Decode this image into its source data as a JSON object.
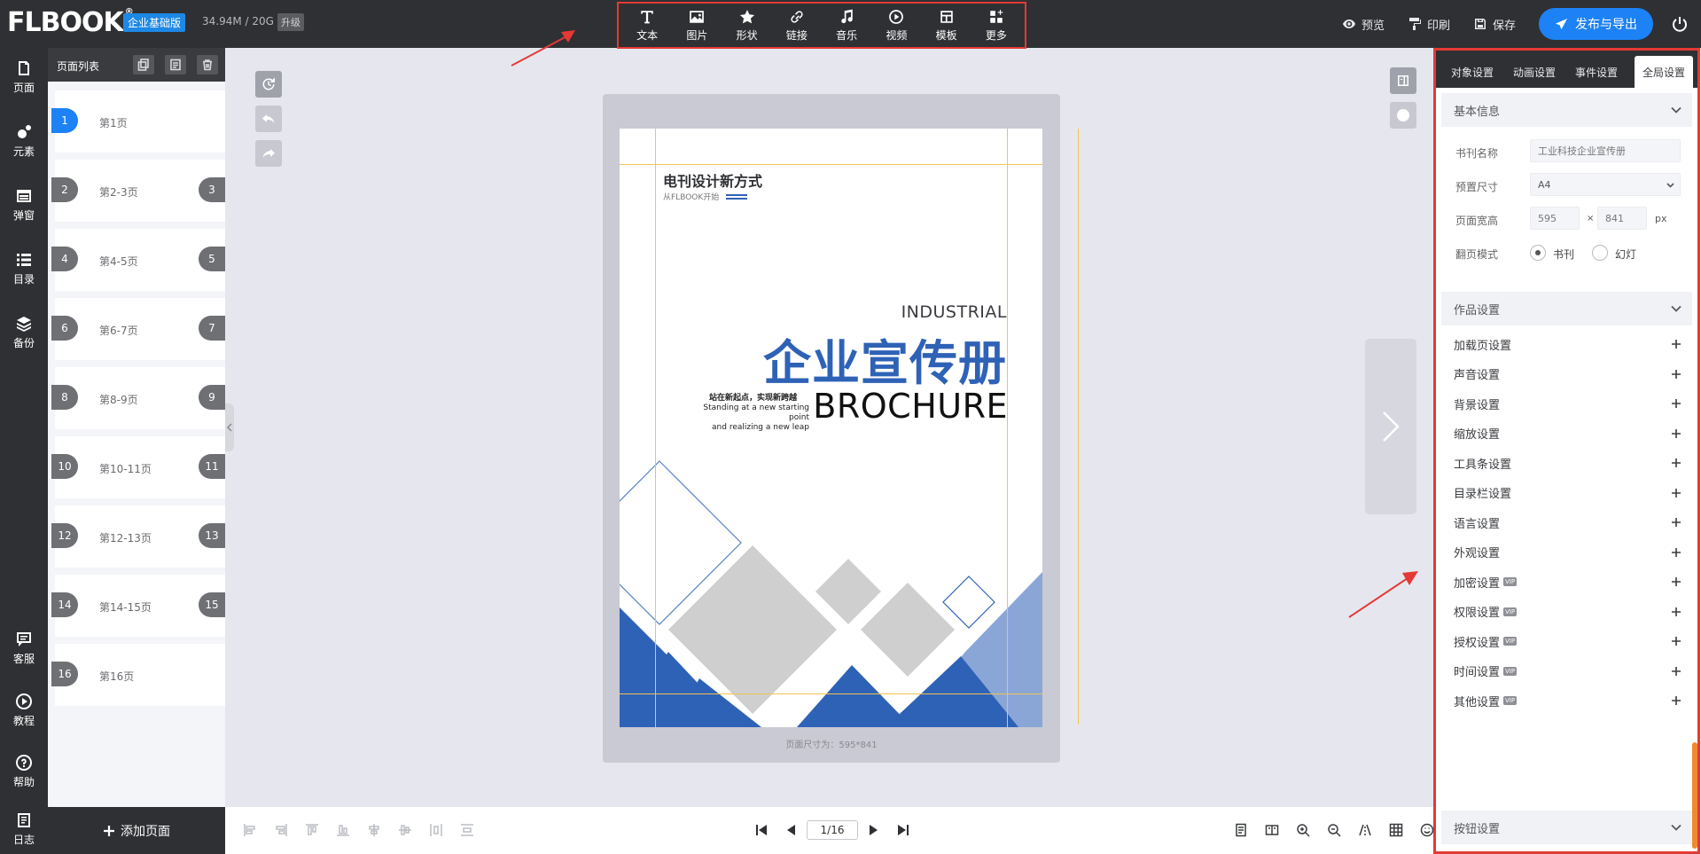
{
  "app": {
    "logo": "FLBOOK",
    "edition": "企业基础版",
    "storage": "34.94M / 20G",
    "upgrade": "升级"
  },
  "toolbar": {
    "items": [
      {
        "label": "文本",
        "icon": "text-icon"
      },
      {
        "label": "图片",
        "icon": "image-icon"
      },
      {
        "label": "形状",
        "icon": "star-icon"
      },
      {
        "label": "链接",
        "icon": "link-icon"
      },
      {
        "label": "音乐",
        "icon": "music-icon"
      },
      {
        "label": "视频",
        "icon": "play-circle-icon"
      },
      {
        "label": "模板",
        "icon": "template-icon"
      },
      {
        "label": "更多",
        "icon": "grid-plus-icon"
      }
    ]
  },
  "topright": {
    "preview": "预览",
    "print": "印刷",
    "save": "保存",
    "publish": "发布与导出"
  },
  "leftnav": {
    "items": [
      {
        "label": "页面",
        "icon": "page-icon"
      },
      {
        "label": "元素",
        "icon": "elements-icon"
      },
      {
        "label": "弹窗",
        "icon": "popup-icon"
      },
      {
        "label": "目录",
        "icon": "list-icon"
      },
      {
        "label": "备份",
        "icon": "layers-icon"
      },
      {
        "label": "客服",
        "icon": "chat-icon"
      },
      {
        "label": "教程",
        "icon": "play-icon"
      },
      {
        "label": "帮助",
        "icon": "help-icon"
      },
      {
        "label": "日志",
        "icon": "log-icon"
      }
    ]
  },
  "pagelist": {
    "title": "页面列表",
    "add_page": "添加页面",
    "pages": [
      {
        "label": "第1页",
        "left": "1",
        "right": ""
      },
      {
        "label": "第2-3页",
        "left": "2",
        "right": "3"
      },
      {
        "label": "第4-5页",
        "left": "4",
        "right": "5"
      },
      {
        "label": "第6-7页",
        "left": "6",
        "right": "7"
      },
      {
        "label": "第8-9页",
        "left": "8",
        "right": "9"
      },
      {
        "label": "第10-11页",
        "left": "10",
        "right": "11"
      },
      {
        "label": "第12-13页",
        "left": "12",
        "right": "13"
      },
      {
        "label": "第14-15页",
        "left": "14",
        "right": "15"
      },
      {
        "label": "第16页",
        "left": "16",
        "right": ""
      }
    ]
  },
  "document": {
    "title_cn": "电刊设计新方式",
    "subtitle": "从FLBOOK开始",
    "industrial": "INDUSTRIAL",
    "main_cn": "企业宣传册",
    "tag1": "站在新起点，实现新跨越",
    "tag2a": "Standing at a new starting point",
    "tag2b": "and realizing a new leap",
    "brochure": "BROCHURE",
    "size_caption": "页面尺寸为：595*841",
    "colors": {
      "blue": "#2e62b6",
      "light_blue": "#8aa6d6",
      "gray": "#cfcfcf"
    }
  },
  "pager": {
    "current": "1/16"
  },
  "rightpanel": {
    "tabs": [
      {
        "label": "对象设置"
      },
      {
        "label": "动画设置"
      },
      {
        "label": "事件设置"
      },
      {
        "label": "全局设置"
      }
    ],
    "basic_info": {
      "title": "基本信息",
      "book_name_label": "书刊名称",
      "book_name_value": "工业科技企业宣传册",
      "preset_label": "预置尺寸",
      "preset_value": "A4",
      "size_label": "页面宽高",
      "width": "595",
      "height": "841",
      "times": "×",
      "unit": "px",
      "flip_label": "翻页模式",
      "flip_book": "书刊",
      "flip_slide": "幻灯"
    },
    "work_settings": {
      "title": "作品设置",
      "items": [
        {
          "label": "加载页设置",
          "vip": ""
        },
        {
          "label": "声音设置",
          "vip": ""
        },
        {
          "label": "背景设置",
          "vip": ""
        },
        {
          "label": "缩放设置",
          "vip": ""
        },
        {
          "label": "工具条设置",
          "vip": ""
        },
        {
          "label": "目录栏设置",
          "vip": ""
        },
        {
          "label": "语言设置",
          "vip": ""
        },
        {
          "label": "外观设置",
          "vip": ""
        },
        {
          "label": "加密设置",
          "vip": "VIP"
        },
        {
          "label": "权限设置",
          "vip": "VIP"
        },
        {
          "label": "授权设置",
          "vip": "VIP"
        },
        {
          "label": "时间设置",
          "vip": "VIP"
        },
        {
          "label": "其他设置",
          "vip": "VIP"
        }
      ]
    },
    "button_settings": {
      "title": "按钮设置"
    }
  },
  "colors": {
    "accent": "#1d82f5",
    "dark": "#2f3033",
    "highlight_red": "#e53935"
  }
}
